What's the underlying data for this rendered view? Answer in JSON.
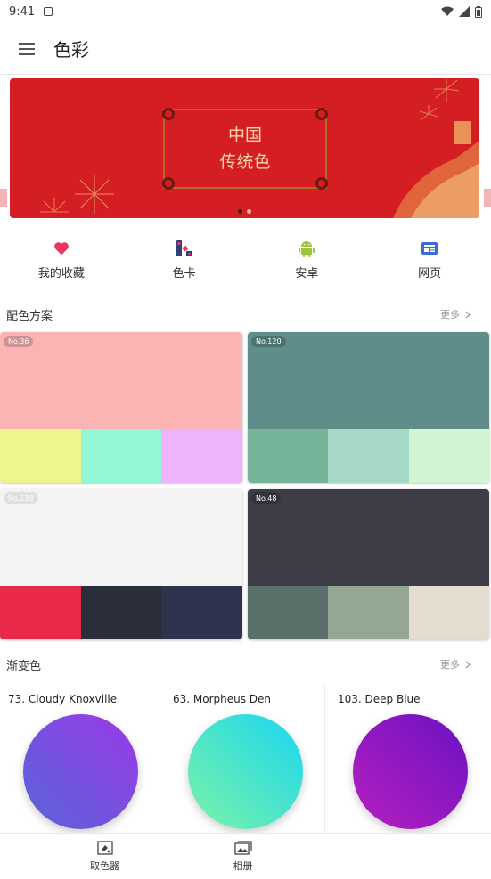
{
  "status_bar": {
    "time": "9:41"
  },
  "app_bar": {
    "title": "色彩"
  },
  "banner": {
    "line1": "中国",
    "line2": "传统色",
    "bg_color": "#d51e23"
  },
  "quick_nav": [
    {
      "label": "我的收藏",
      "icon": "heart-icon"
    },
    {
      "label": "色卡",
      "icon": "color-card-icon"
    },
    {
      "label": "安卓",
      "icon": "android-icon"
    },
    {
      "label": "网页",
      "icon": "web-icon"
    }
  ],
  "schemes_section": {
    "title": "配色方案",
    "more": "更多"
  },
  "schemes": [
    {
      "tag": "No.36",
      "main": "#fbb3b4",
      "colors": [
        "#eef58e",
        "#94f6d6",
        "#efb3fb"
      ]
    },
    {
      "tag": "No.120",
      "main": "#5f8d89",
      "colors": [
        "#76b49a",
        "#a5d8c6",
        "#d2f4d3"
      ]
    },
    {
      "tag": "No.118",
      "main": "#f4f4f4",
      "colors": [
        "#e8294a",
        "#2a2d3a",
        "#2e344e"
      ]
    },
    {
      "tag": "No.48",
      "main": "#3e3d47",
      "colors": [
        "#5a6f69",
        "#94a793",
        "#e4dccf"
      ]
    }
  ],
  "gradient_section": {
    "title": "渐变色",
    "more": "更多"
  },
  "gradients": [
    {
      "name": "73. Cloudy Knoxville",
      "from": "#5865d8",
      "to": "#9b39e6"
    },
    {
      "name": "63. Morpheus Den",
      "from": "#7df3a6",
      "to": "#19d6f2"
    },
    {
      "name": "103. Deep Blue",
      "from": "#b61fbf",
      "to": "#6a12c2"
    }
  ],
  "bottom_nav": [
    {
      "label": "取色器",
      "icon": "color-picker-icon"
    },
    {
      "label": "相册",
      "icon": "gallery-icon"
    }
  ]
}
